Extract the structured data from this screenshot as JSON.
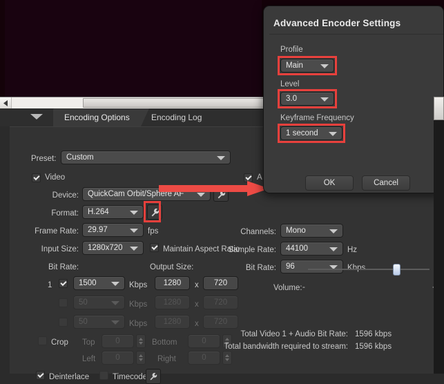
{
  "preview": {
    "name": "video-preview",
    "background_color": "#190310"
  },
  "scrollbar": {
    "horizontal_icon": "left-arrow-icon",
    "vertical_present": true
  },
  "tabs": [
    {
      "label": "Encoding Options",
      "active": true
    },
    {
      "label": "Encoding Log",
      "active": false
    }
  ],
  "collapse_arrow_icon": "chevron-down-icon",
  "encoding_options": {
    "preset": {
      "label": "Preset:",
      "value": "Custom"
    },
    "video": {
      "checkbox_label": "Video",
      "checked": true,
      "device": {
        "label": "Device:",
        "value": "QuickCam Orbit/Sphere AF",
        "settings_icon": "wrench-icon"
      },
      "format": {
        "label": "Format:",
        "value": "H.264",
        "settings_icon": "wrench-icon",
        "highlighted": true
      },
      "frame_rate": {
        "label": "Frame Rate:",
        "value": "29.97",
        "unit": "fps"
      },
      "input_size": {
        "label": "Input Size:",
        "value": "1280x720"
      },
      "maintain_aspect_ratio": {
        "label": "Maintain Aspect Ratio",
        "checked": true
      },
      "bit_rate_header": "Bit Rate:",
      "output_size_header": "Output Size:",
      "unit_kbps": "Kbps",
      "x_separator": "x",
      "streams": [
        {
          "index": "1",
          "enabled": true,
          "bitrate": "1500",
          "width": "1280",
          "height": "720"
        },
        {
          "index": "",
          "enabled": false,
          "bitrate": "50",
          "width": "1280",
          "height": "720"
        },
        {
          "index": "",
          "enabled": false,
          "bitrate": "50",
          "width": "1280",
          "height": "720"
        }
      ],
      "crop": {
        "label": "Crop",
        "checked": false,
        "top": {
          "label": "Top",
          "value": "0"
        },
        "bottom": {
          "label": "Bottom",
          "value": "0"
        },
        "left": {
          "label": "Left",
          "value": "0"
        },
        "right": {
          "label": "Right",
          "value": "0"
        }
      },
      "deinterlace": {
        "label": "Deinterlace",
        "checked": true
      },
      "timecode": {
        "label": "Timecode",
        "checked": false,
        "settings_icon": "wrench-icon"
      }
    },
    "audio": {
      "checkbox_label": "A",
      "checked": true,
      "channels": {
        "label": "Channels:",
        "value": "Mono"
      },
      "sample_rate": {
        "label": "Sample Rate:",
        "value": "44100",
        "unit": "Hz"
      },
      "bit_rate": {
        "label": "Bit Rate:",
        "value": "96",
        "unit": "Kbps"
      },
      "volume": {
        "label": "Volume:",
        "minus": "-",
        "plus": "+",
        "percent": 70
      }
    },
    "summary": [
      {
        "label": "Total Video 1 + Audio Bit Rate:",
        "value": "1596 kbps"
      },
      {
        "label": "Total bandwidth required to stream:",
        "value": "1596 kbps"
      }
    ]
  },
  "dialog": {
    "title": "Advanced Encoder Settings",
    "fields": [
      {
        "label": "Profile",
        "value": "Main",
        "highlighted": true
      },
      {
        "label": "Level",
        "value": "3.0",
        "highlighted": true
      },
      {
        "label": "Keyframe Frequency",
        "value": "1 second",
        "highlighted": true
      }
    ],
    "ok_label": "OK",
    "cancel_label": "Cancel"
  },
  "annotation": {
    "color": "#e8403c",
    "arrow_from": "format-settings-button",
    "arrow_to": "advanced-encoder-settings-dialog"
  }
}
